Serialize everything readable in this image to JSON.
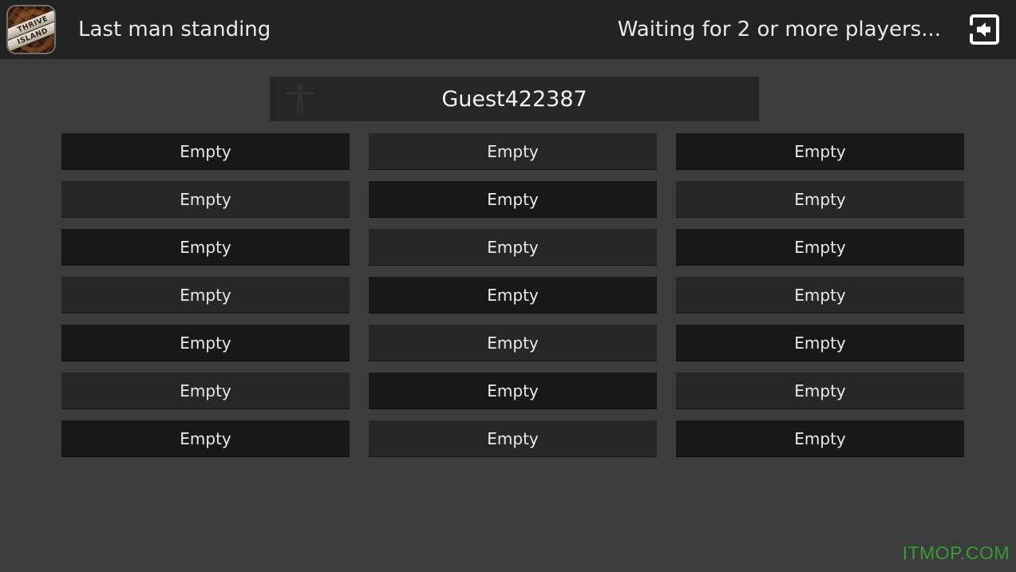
{
  "header": {
    "app_icon": {
      "name": "thrive-island-app-icon",
      "line1": "THRIVE",
      "line2": "ISLAND"
    },
    "title": "Last man standing",
    "status": "Waiting for 2 or more players...",
    "exit_icon": "exit-door-arrow-icon"
  },
  "player_bar": {
    "avatar_icon": "player-silhouette-icon",
    "name": "Guest422387"
  },
  "slots": {
    "empty_label": "Empty",
    "columns": 3,
    "rows": 7,
    "items": [
      {
        "label": "Empty",
        "shade": "dark"
      },
      {
        "label": "Empty",
        "shade": "light"
      },
      {
        "label": "Empty",
        "shade": "dark"
      },
      {
        "label": "Empty",
        "shade": "light"
      },
      {
        "label": "Empty",
        "shade": "dark"
      },
      {
        "label": "Empty",
        "shade": "light"
      },
      {
        "label": "Empty",
        "shade": "dark"
      },
      {
        "label": "Empty",
        "shade": "light"
      },
      {
        "label": "Empty",
        "shade": "dark"
      },
      {
        "label": "Empty",
        "shade": "light"
      },
      {
        "label": "Empty",
        "shade": "dark"
      },
      {
        "label": "Empty",
        "shade": "light"
      },
      {
        "label": "Empty",
        "shade": "dark"
      },
      {
        "label": "Empty",
        "shade": "light"
      },
      {
        "label": "Empty",
        "shade": "dark"
      },
      {
        "label": "Empty",
        "shade": "light"
      },
      {
        "label": "Empty",
        "shade": "dark"
      },
      {
        "label": "Empty",
        "shade": "light"
      },
      {
        "label": "Empty",
        "shade": "dark"
      },
      {
        "label": "Empty",
        "shade": "light"
      },
      {
        "label": "Empty",
        "shade": "dark"
      }
    ]
  },
  "watermark": "ITMOP.COM",
  "colors": {
    "header_bg": "#232323",
    "body_bg": "#3c3c3c",
    "slot_dark": "#181818",
    "slot_light": "#272727",
    "text": "#eaeaea",
    "watermark_green": "#3a9a35"
  }
}
